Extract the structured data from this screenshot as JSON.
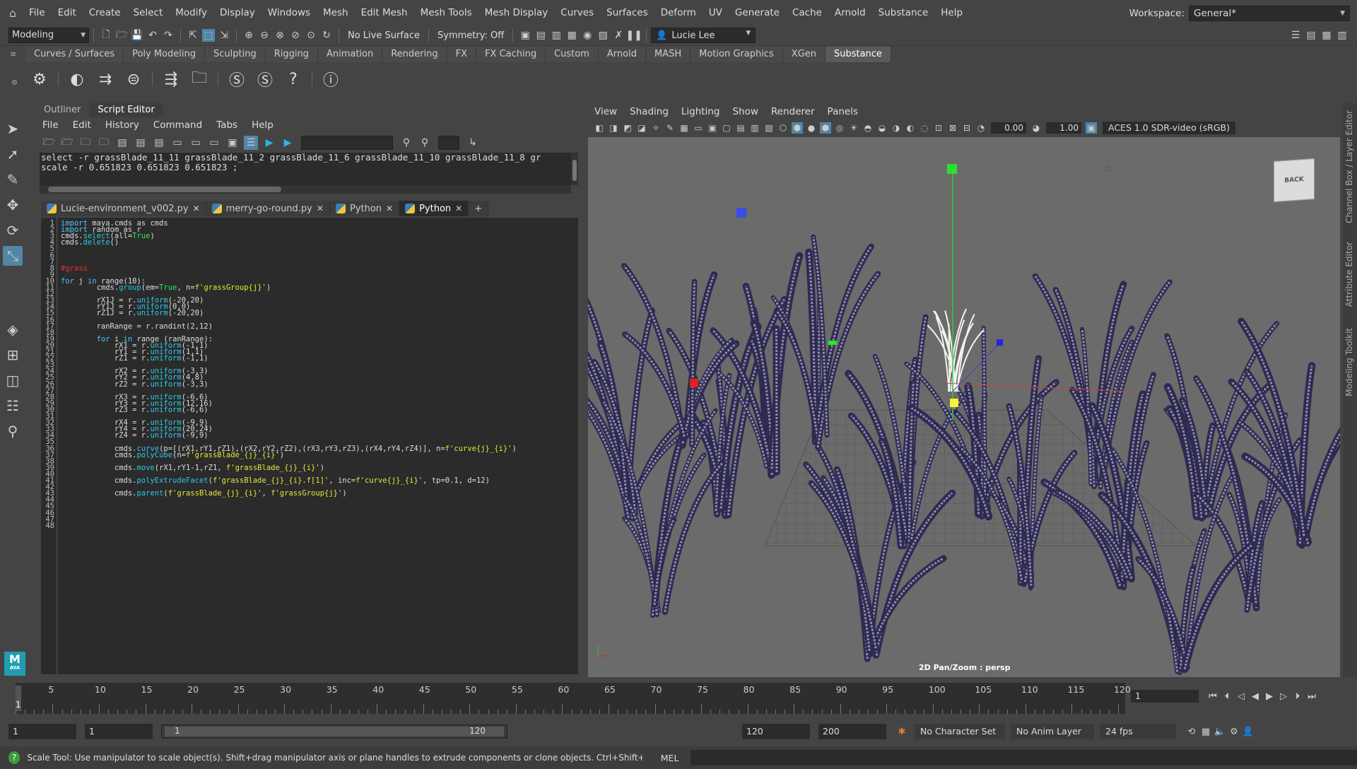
{
  "menubar": {
    "items": [
      "File",
      "Edit",
      "Create",
      "Select",
      "Modify",
      "Display",
      "Windows",
      "Mesh",
      "Edit Mesh",
      "Mesh Tools",
      "Mesh Display",
      "Curves",
      "Surfaces",
      "Deform",
      "UV",
      "Generate",
      "Cache",
      "Arnold",
      "Substance",
      "Help"
    ],
    "workspace_label": "Workspace:",
    "workspace_value": "General*"
  },
  "statusline": {
    "mode": "Modeling",
    "live_surface": "No Live Surface",
    "symmetry": "Symmetry: Off",
    "user": "Lucie Lee"
  },
  "shelf": {
    "tabs": [
      "Curves / Surfaces",
      "Poly Modeling",
      "Sculpting",
      "Rigging",
      "Animation",
      "Rendering",
      "FX",
      "FX Caching",
      "Custom",
      "Arnold",
      "MASH",
      "Motion Graphics",
      "XGen",
      "Substance"
    ],
    "active_tab": "Substance"
  },
  "panel_tabs": [
    "Outliner",
    "Script Editor"
  ],
  "script_editor": {
    "menu": [
      "File",
      "Edit",
      "History",
      "Command",
      "Tabs",
      "Help"
    ],
    "history": [
      "select -r grassBlade_11_11 grassBlade_11_2 grassBlade_11_6 grassBlade_11_10 grassBlade_11_8 gr",
      "scale -r 0.651823 0.651823 0.651823 ;"
    ],
    "file_tabs": [
      "Lucie-environment_v002.py",
      "merry-go-round.py",
      "Python",
      "Python"
    ],
    "add_tab": "+",
    "line_count": 48
  },
  "viewport": {
    "menu": [
      "View",
      "Shading",
      "Lighting",
      "Show",
      "Renderer",
      "Panels"
    ],
    "exposure": "0.00",
    "gamma": "1.00",
    "color_space": "ACES 1.0 SDR-video (sRGB)",
    "viewcube_label": "BACK",
    "camera_label": "2D Pan/Zoom : persp"
  },
  "right_strip": [
    "Channel Box / Layer Editor",
    "Attribute Editor",
    "Modeling Toolkit"
  ],
  "timeline": {
    "ticks": [
      5,
      10,
      15,
      20,
      25,
      30,
      35,
      40,
      45,
      50,
      55,
      60,
      65,
      70,
      75,
      80,
      85,
      90,
      95,
      100,
      105,
      110,
      115,
      120
    ],
    "current_frame": "1",
    "max_frame": 120,
    "current_field": "1"
  },
  "range": {
    "start": "1",
    "anim_start": "1",
    "slider_start": "1",
    "slider_end": "120",
    "end": "120",
    "anim_end": "200",
    "character_set": "No Character Set",
    "anim_layer": "No Anim Layer",
    "fps": "24 fps"
  },
  "help": {
    "text": "Scale Tool: Use manipulator to scale object(s). Shift+drag manipulator axis or plane handles to extrude components or clone objects. Ctrl+Shift+LMB+drag to constrain scal",
    "mel_label": "MEL"
  },
  "maya_logo": {
    "letter": "M",
    "sub": "AYA"
  },
  "colors": {
    "accent": "#5285a6",
    "keyword": "#4fc3ff",
    "string": "#e6e63a",
    "comment": "#e63232",
    "bool": "#34e26b"
  }
}
